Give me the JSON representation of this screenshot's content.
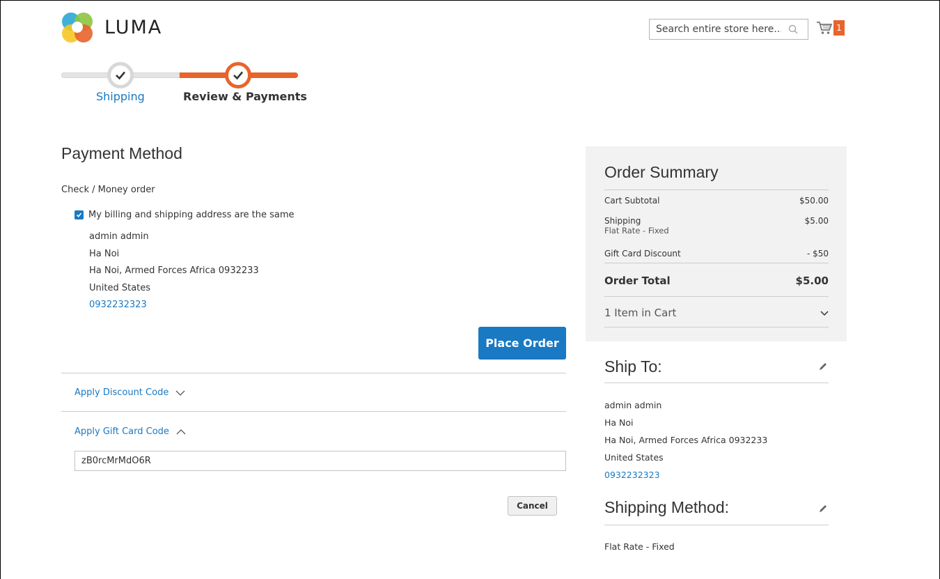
{
  "header": {
    "logo_text": "LUMA",
    "search_placeholder": "Search entire store here...",
    "cart_count": "1"
  },
  "progress": {
    "steps": [
      {
        "label": "Shipping",
        "completed": true
      },
      {
        "label": "Review & Payments",
        "active": true
      }
    ]
  },
  "payment": {
    "title": "Payment Method",
    "method": "Check / Money order",
    "same_address_label": "My billing and shipping address are the same",
    "same_address_checked": true,
    "address": {
      "name": "admin admin",
      "city": "Ha Noi",
      "region_line": "Ha Noi, Armed Forces Africa 0932233",
      "country": "United States",
      "phone": "0932232323"
    },
    "place_order_label": "Place Order"
  },
  "discount": {
    "discount_label": "Apply Discount Code",
    "gift_label": "Apply Gift Card Code",
    "gift_value": "zB0rcMrMdO6R",
    "cancel_label": "Cancel"
  },
  "summary": {
    "title": "Order Summary",
    "rows": {
      "subtotal_label": "Cart Subtotal",
      "subtotal_value": "$50.00",
      "shipping_label": "Shipping",
      "shipping_sub": "Flat Rate - Fixed",
      "shipping_value": "$5.00",
      "gift_label": "Gift Card Discount",
      "gift_value": "- $50",
      "total_label": "Order Total",
      "total_value": "$5.00"
    },
    "items_in_cart": "1 Item in Cart"
  },
  "ship_to": {
    "title": "Ship To:",
    "name": "admin admin",
    "city": "Ha Noi",
    "region_line": "Ha Noi, Armed Forces Africa 0932233",
    "country": "United States",
    "phone": "0932232323"
  },
  "shipping_method": {
    "title": "Shipping Method:",
    "value": "Flat Rate - Fixed"
  },
  "colors": {
    "accent_blue": "#1979c3",
    "accent_orange": "#e8642c",
    "summary_bg": "#f2f2f2"
  }
}
